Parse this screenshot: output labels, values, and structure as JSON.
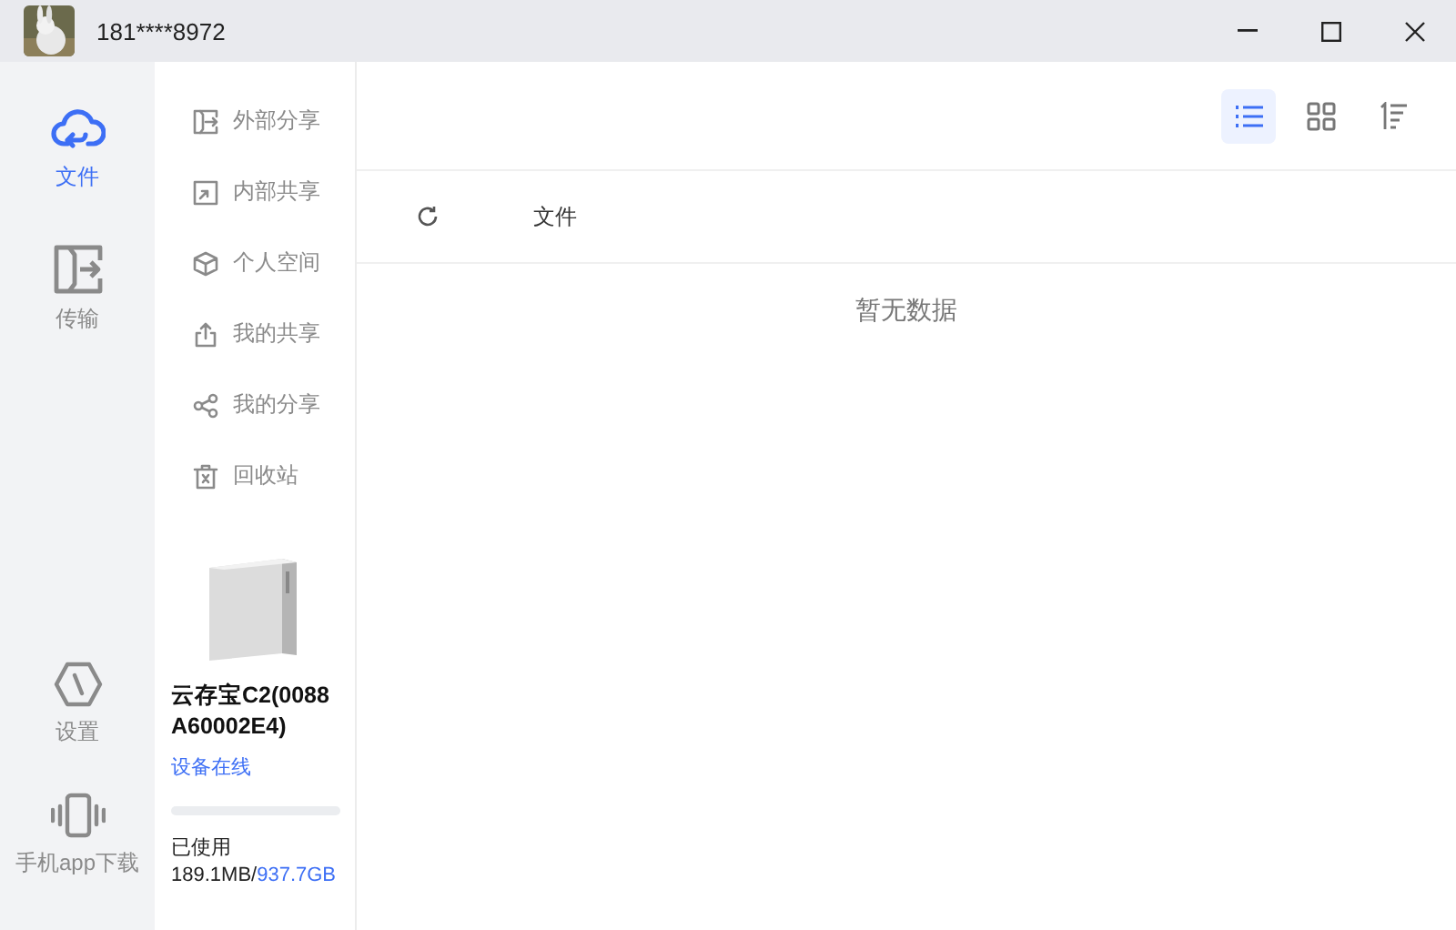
{
  "title_bar": {
    "account": "181****8972"
  },
  "nav_rail": [
    {
      "kind": "cloud",
      "label": "文件",
      "selected": true
    },
    {
      "kind": "transfer",
      "label": "传输",
      "selected": false
    }
  ],
  "nav_rail_bottom": [
    {
      "kind": "settings",
      "label": "设置"
    },
    {
      "kind": "phone",
      "label": "手机app下载"
    }
  ],
  "categories": [
    {
      "kind": "external",
      "label": "外部分享"
    },
    {
      "kind": "internal",
      "label": "内部共享"
    },
    {
      "kind": "personal",
      "label": "个人空间"
    },
    {
      "kind": "my_shared",
      "label": "我的共享"
    },
    {
      "kind": "my_share",
      "label": "我的分享"
    },
    {
      "kind": "trash",
      "label": "回收站"
    }
  ],
  "device": {
    "name": "云存宝C2(0088A60002E4)",
    "status": "设备在线",
    "usage_label": "已使用",
    "used": "189.1MB/",
    "total": "937.7GB",
    "level": 0.0002
  },
  "views": [
    {
      "kind": "list",
      "selected": true
    },
    {
      "kind": "grid",
      "selected": false
    }
  ],
  "table": {
    "columns": [
      "文件"
    ]
  },
  "empty_text": "暂无数据"
}
